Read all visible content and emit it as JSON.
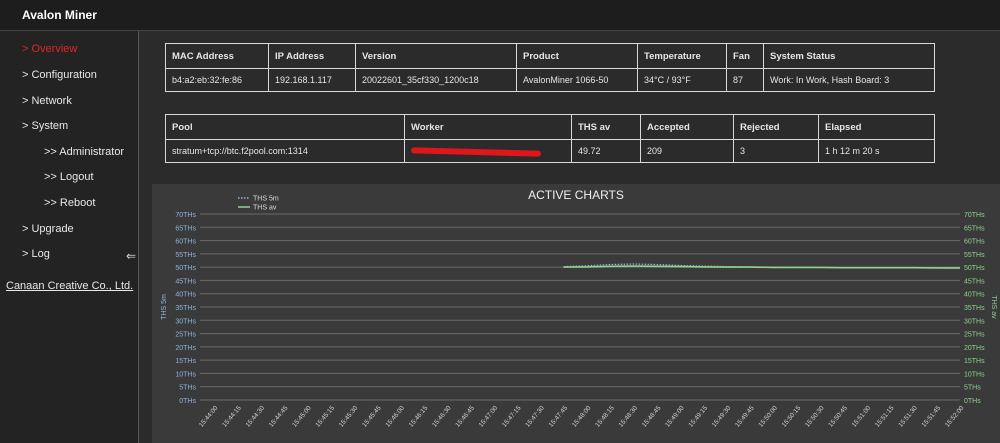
{
  "app": {
    "title": "Avalon Miner"
  },
  "sidebar": {
    "items": [
      {
        "label": "> Overview",
        "active": true
      },
      {
        "label": "> Configuration"
      },
      {
        "label": "> Network"
      },
      {
        "label": "> System"
      },
      {
        "label": ">> Administrator"
      },
      {
        "label": ">> Logout"
      },
      {
        "label": ">> Reboot"
      },
      {
        "label": "> Upgrade"
      },
      {
        "label": "> Log"
      }
    ],
    "collapse_icon": "double-arrow-left-icon",
    "company": "Canaan Creative Co., Ltd."
  },
  "device_table": {
    "headers": [
      "MAC Address",
      "IP Address",
      "Version",
      "Product",
      "Temperature",
      "Fan",
      "System Status"
    ],
    "row": [
      "b4:a2:eb:32:fe:86",
      "192.168.1.117",
      "20022601_35cf330_1200c18",
      "AvalonMiner 1066-50",
      "34°C / 93°F",
      "87",
      "Work: In Work, Hash Board: 3"
    ]
  },
  "pool_table": {
    "headers": [
      "Pool",
      "Worker",
      "THS av",
      "Accepted",
      "Rejected",
      "Elapsed"
    ],
    "row": [
      "stratum+tcp://btc.f2pool.com:1314",
      "",
      "49.72",
      "209",
      "3",
      "1 h 12 m 20 s"
    ],
    "worker_redacted": true
  },
  "chart": {
    "title": "ACTIVE CHARTS"
  },
  "chart_data": {
    "type": "line",
    "title": "ACTIVE CHARTS",
    "ylabel": "THS 5m",
    "y2label": "THS av",
    "ylim": [
      0,
      70
    ],
    "yticks": [
      "0THs",
      "5THs",
      "10THs",
      "15THs",
      "20THs",
      "25THs",
      "30THs",
      "35THs",
      "40THs",
      "45THs",
      "50THs",
      "55THs",
      "60THs",
      "65THs",
      "70THs"
    ],
    "legend_placement": "top-left",
    "grid": true,
    "x": [
      "15:44:00",
      "15:44:15",
      "15:44:30",
      "15:44:45",
      "15:45:00",
      "15:45:15",
      "15:45:30",
      "15:45:45",
      "15:46:00",
      "15:46:15",
      "15:46:30",
      "15:46:45",
      "15:47:00",
      "15:47:15",
      "15:47:30",
      "15:47:45",
      "15:48:00",
      "15:48:15",
      "15:48:30",
      "15:48:45",
      "15:49:00",
      "15:49:15",
      "15:49:30",
      "15:49:45",
      "15:50:00",
      "15:50:15",
      "15:50:30",
      "15:50:45",
      "15:51:00",
      "15:51:15",
      "15:51:30",
      "15:51:45",
      "15:52:00"
    ],
    "series": [
      {
        "name": "THS 5m",
        "color": "#9ab3d8",
        "dashed": true,
        "values": [
          null,
          null,
          null,
          null,
          null,
          null,
          null,
          null,
          null,
          null,
          null,
          null,
          null,
          null,
          null,
          50.2,
          50.5,
          51.0,
          51.2,
          51.0,
          50.6,
          50.4,
          50.2,
          50.1,
          50.0,
          50.0,
          49.9,
          49.8,
          49.8,
          49.8,
          49.7,
          49.7,
          49.6
        ]
      },
      {
        "name": "THS av",
        "color": "#8fd18f",
        "dashed": false,
        "values": [
          null,
          null,
          null,
          null,
          null,
          null,
          null,
          null,
          null,
          null,
          null,
          null,
          null,
          null,
          null,
          50.0,
          50.1,
          50.3,
          50.4,
          50.3,
          50.2,
          50.1,
          50.0,
          50.0,
          49.9,
          49.9,
          49.9,
          49.8,
          49.8,
          49.8,
          49.8,
          49.7,
          49.7
        ]
      }
    ]
  }
}
